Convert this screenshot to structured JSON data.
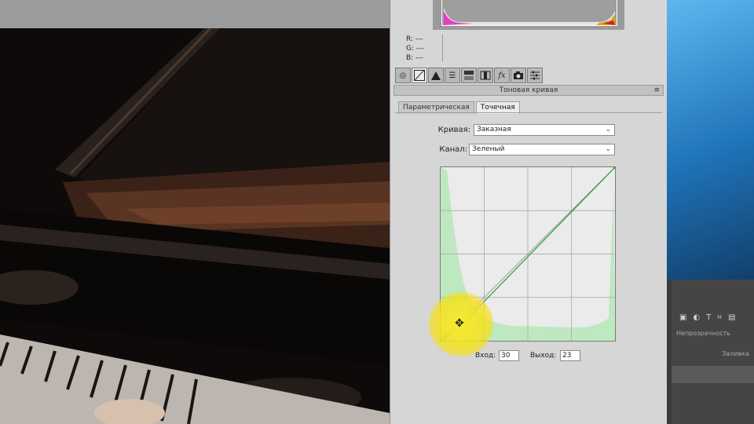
{
  "info": {
    "r_label": "R:",
    "g_label": "G:",
    "b_label": "B:",
    "r_value": "---",
    "g_value": "---",
    "b_value": "---"
  },
  "toolbar": {
    "icons": [
      "basic-icon",
      "tone-curve-icon",
      "detail-icon",
      "hsl-icon",
      "split-toning-icon",
      "lens-icon",
      "fx-icon",
      "camera-calibration-icon",
      "presets-icon"
    ],
    "active_index": 1
  },
  "panel": {
    "title": "Тоновая кривая",
    "menu_glyph": "≡"
  },
  "tabs": [
    {
      "label": "Параметрическая"
    },
    {
      "label": "Точечная"
    }
  ],
  "active_tab": "Точечная",
  "curve_select": {
    "label": "Кривая:",
    "value": "Заказная"
  },
  "channel_select": {
    "label": "Канал:",
    "value": "Зеленый"
  },
  "input": {
    "label": "Вход:",
    "value": "30"
  },
  "output": {
    "label": "Выход:",
    "value": "23"
  },
  "curve": {
    "channel_color": "#3aa045",
    "histogram_color": "#bde8c0",
    "points": [
      [
        0,
        0
      ],
      [
        30,
        23
      ],
      [
        255,
        255
      ]
    ]
  },
  "desktop": {
    "opacity_label": "Непрозрачность",
    "fill_label": "Заливка"
  },
  "colors": {
    "panel_bg": "#d6d6d6",
    "highlight": "#f5e31e"
  }
}
